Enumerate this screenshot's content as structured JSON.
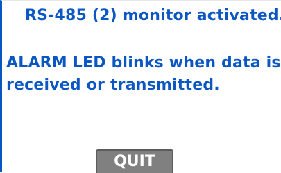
{
  "screen": {
    "title": "RS-485 (2) monitor activated.",
    "message_line_1": "ALARM LED blinks when data is",
    "message_line_2": "received or transmitted."
  },
  "buttons": {
    "quit_label": "QUIT"
  },
  "colors": {
    "text": "#0a57c4",
    "button_bg": "#808080",
    "button_text": "#ffffff",
    "background": "#ffffff"
  }
}
